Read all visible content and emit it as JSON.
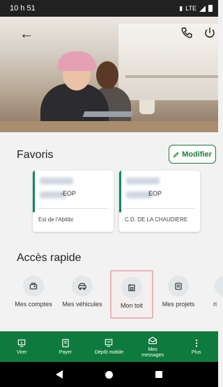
{
  "status_bar": {
    "time": "10 h 51",
    "network": "LTE"
  },
  "header": {
    "icons": [
      "back-arrow-icon",
      "phone-icon",
      "power-icon"
    ]
  },
  "favorites": {
    "title": "Favoris",
    "modify_label": "Modifier",
    "cards": [
      {
        "account_suffix": "-EOP",
        "institution": "Est de l'Abitibi"
      },
      {
        "account_suffix": "EOP",
        "institution": "C.D. DE LA CHAUDIERE"
      }
    ]
  },
  "quick_access": {
    "title": "Accès rapide",
    "items": [
      {
        "label": "Mes comptes",
        "icon": "wallet-icon"
      },
      {
        "label": "Mes véhicules",
        "icon": "car-icon"
      },
      {
        "label": "Mon toit",
        "icon": "house-icon",
        "selected": true
      },
      {
        "label": "Mes projets",
        "icon": "folder-icon"
      },
      {
        "label": "ri",
        "icon": "partial-icon"
      }
    ]
  },
  "bottom_nav": {
    "items": [
      {
        "label": "Virer",
        "icon": "transfer-icon"
      },
      {
        "label": "Payer",
        "icon": "pay-icon"
      },
      {
        "label": "Dépôt mobile",
        "icon": "mobile-deposit-icon"
      },
      {
        "label": "Mes messages",
        "icon": "envelope-icon"
      },
      {
        "label": "Plus",
        "icon": "more-icon"
      }
    ]
  },
  "colors": {
    "accent": "#1b7a3a",
    "nav_background": "#0f7a3d",
    "card_bar": "#0e8a5f",
    "selection_border": "#e7b6b6"
  }
}
